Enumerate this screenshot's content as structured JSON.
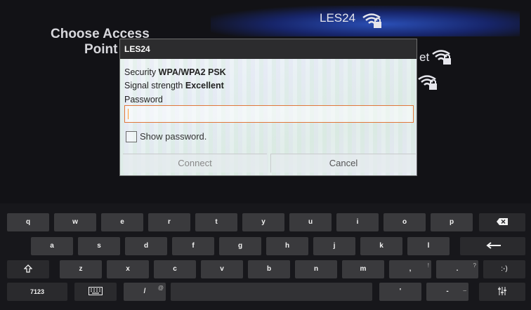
{
  "background": {
    "title_line1": "Choose Access",
    "title_line2": "Point",
    "ssid_top": "LES24",
    "right_fragment": "et"
  },
  "dialog": {
    "title": "LES24",
    "security_label": "Security",
    "security_value": "WPA/WPA2 PSK",
    "signal_label": "Signal strength",
    "signal_value": "Excellent",
    "password_label": "Password",
    "password_value": "",
    "show_password_label": "Show password.",
    "connect_label": "Connect",
    "cancel_label": "Cancel"
  },
  "keyboard": {
    "row1": [
      "q",
      "w",
      "e",
      "r",
      "t",
      "y",
      "u",
      "i",
      "o",
      "p"
    ],
    "row2": [
      "a",
      "s",
      "d",
      "f",
      "g",
      "h",
      "j",
      "k",
      "l"
    ],
    "row3": [
      "z",
      "x",
      "c",
      "v",
      "b",
      "n",
      "m",
      ",",
      "."
    ],
    "row3_hints": {
      ",": "!",
      ".": "?"
    },
    "smiley": ":-)",
    "numbers": "7123",
    "slash": "/",
    "slash_hint": "@",
    "apostrophe": "'",
    "dash": "-",
    "dash_hint": "_"
  }
}
